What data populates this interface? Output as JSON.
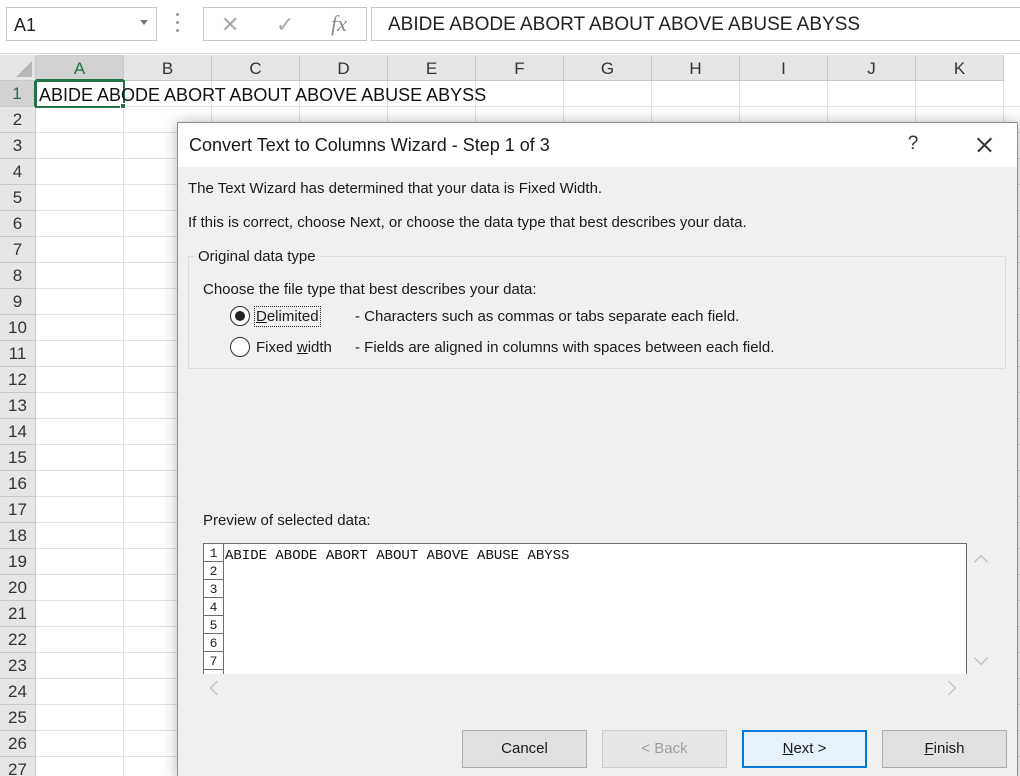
{
  "formula_bar": {
    "name_box": "A1",
    "cancel_icon": "cancel-icon",
    "enter_icon": "enter-icon",
    "fx_label": "fx",
    "formula_value": "ABIDE ABODE ABORT ABOUT ABOVE ABUSE ABYSS"
  },
  "sheet": {
    "columns": [
      "A",
      "B",
      "C",
      "D",
      "E",
      "F",
      "G",
      "H",
      "I",
      "J",
      "K"
    ],
    "rows": [
      "1",
      "2",
      "3",
      "4",
      "5",
      "6",
      "7",
      "8",
      "9",
      "10",
      "11",
      "12",
      "13",
      "14",
      "15",
      "16",
      "17",
      "18",
      "19",
      "20",
      "21",
      "22",
      "23",
      "24",
      "25",
      "26",
      "27"
    ],
    "selected_cell": "A1",
    "cell_a1": "ABIDE ABODE ABORT ABOUT ABOVE ABUSE ABYSS",
    "accent_color": "#217346"
  },
  "dialog": {
    "title": "Convert Text to Columns Wizard - Step 1 of 3",
    "help": "?",
    "message_1": "The Text Wizard has determined that your data is Fixed Width.",
    "message_2": "If this is correct, choose Next, or choose the data type that best describes your data.",
    "group_title": "Original data type",
    "choose_label": "Choose the file type that best describes your data:",
    "options": [
      {
        "label": "Delimited",
        "description": "- Characters such as commas or tabs separate each field.",
        "checked": true
      },
      {
        "label": "Fixed width",
        "description": "- Fields are aligned in columns with spaces between each field.",
        "checked": false
      }
    ],
    "preview_label": "Preview of selected data:",
    "preview_rows": [
      "1",
      "2",
      "3",
      "4",
      "5",
      "6",
      "7"
    ],
    "preview_line_1": "ABIDE ABODE ABORT ABOUT ABOVE ABUSE ABYSS",
    "buttons": {
      "cancel": "Cancel",
      "back": "< Back",
      "next": "Next >",
      "finish": "Finish"
    }
  }
}
